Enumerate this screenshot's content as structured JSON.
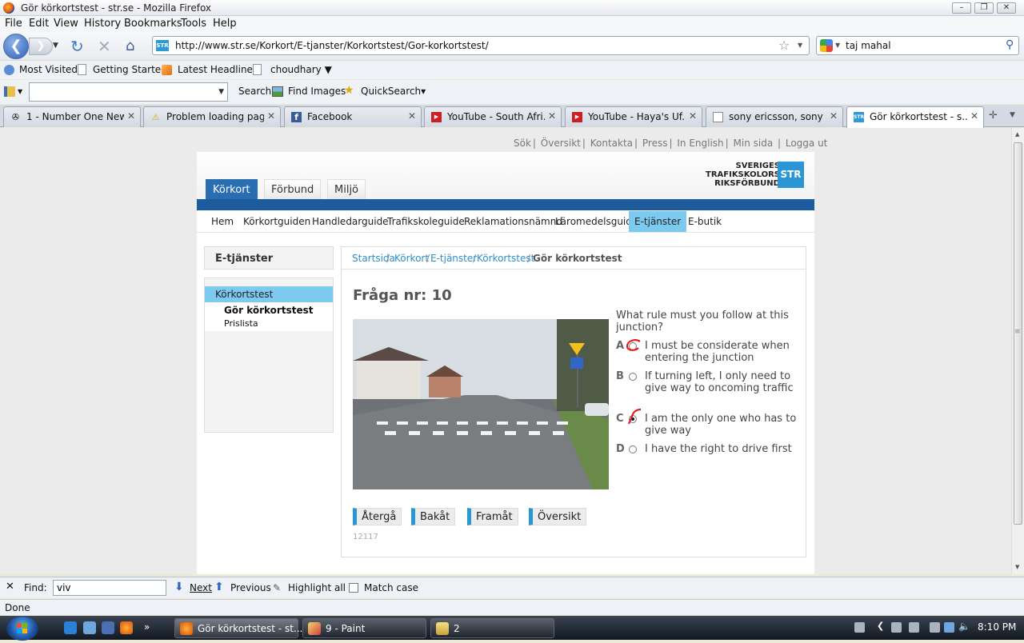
{
  "window": {
    "title": "Gör körkortstest - str.se - Mozilla Firefox"
  },
  "menu": [
    "File",
    "Edit",
    "View",
    "History",
    "Bookmarks",
    "Tools",
    "Help"
  ],
  "nav": {
    "url": "http://www.str.se/Korkort/E-tjanster/Korkortstest/Gor-korkortstest/",
    "site_icon": "STR",
    "search_query": "taj mahal"
  },
  "bookmarks": [
    "Most Visited",
    "Getting Started",
    "Latest Headlines",
    "choudhary ▼"
  ],
  "toolbar2": {
    "search": "Search",
    "find_images": "Find Images",
    "quicksearch": "QuickSearch▾"
  },
  "tabs": [
    {
      "label": "1 - Number One New...",
      "icon": "gear-icon"
    },
    {
      "label": "Problem loading page",
      "icon": "warning-icon"
    },
    {
      "label": "Facebook",
      "icon": "facebook-icon"
    },
    {
      "label": "YouTube - South Afri...",
      "icon": "youtube-icon"
    },
    {
      "label": "YouTube - Haya's Uf...",
      "icon": "youtube-icon"
    },
    {
      "label": "sony ericsson, sony e...",
      "icon": "page-icon"
    },
    {
      "label": "Gör körkortstest - s...",
      "icon": "str-icon",
      "active": true
    }
  ],
  "page": {
    "util_links": [
      "Sök",
      "Översikt",
      "Kontakta",
      "Press",
      "In English",
      "Min sida",
      "Logga ut"
    ],
    "main_tabs": [
      "Körkort",
      "Förbund",
      "Miljö"
    ],
    "logo": {
      "line1": "SVERIGES",
      "line2": "TRAFIKSKOLORS",
      "line3": "RIKSFÖRBUND",
      "mark": "STR"
    },
    "subnav": [
      "Hem",
      "Körkortguiden",
      "Handledarguide",
      "Trafikskoleguide",
      "Reklamationsnämnd",
      "Läromedelsguide",
      "E-tjänster",
      "E-butik"
    ],
    "sidebar": {
      "heading": "E-tjänster",
      "selected": "Körkortstest",
      "items": [
        "Gör körkortstest",
        "Prislista"
      ]
    },
    "breadcrumb": {
      "items": [
        "Startsida",
        "Körkort",
        "E-tjänster",
        "Körkortstest"
      ],
      "current": "Gör körkortstest",
      "sep": " / "
    },
    "question_title": "Fråga nr: 10",
    "question": "What rule must you follow at this junction?",
    "options": [
      {
        "letter": "A",
        "text": "I must be considerate when entering the junction"
      },
      {
        "letter": "B",
        "text": "If turning left, I only need to give way to oncoming traffic"
      },
      {
        "letter": "C",
        "text": "I am the only one who has to give way"
      },
      {
        "letter": "D",
        "text": "I have the right to drive first"
      }
    ],
    "buttons": [
      "Återgå",
      "Bakåt",
      "Framåt",
      "Översikt"
    ],
    "code": "12117"
  },
  "findbar": {
    "label": "Find:",
    "value": "viv",
    "next": "Next",
    "previous": "Previous",
    "highlight": "Highlight all",
    "match_case": "Match case"
  },
  "status": "Done",
  "taskbar": {
    "items": [
      "Gör körkortstest - st...",
      "9 - Paint",
      "2"
    ],
    "clock": "8:10 PM"
  }
}
